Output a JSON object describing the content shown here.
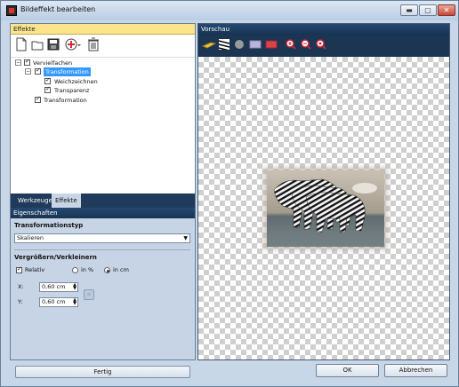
{
  "window": {
    "title": "Bildeffekt bearbeiten"
  },
  "titlebar": {
    "min": "▬",
    "max": "▢",
    "close": "✕"
  },
  "left_panel": {
    "header": "Effekte",
    "tree": [
      {
        "label": "Vervielfachen",
        "checked": true
      },
      {
        "label": "Transformation",
        "checked": true,
        "selected": true
      },
      {
        "label": "Weichzeichnen",
        "checked": true
      },
      {
        "label": "Transparenz",
        "checked": true
      },
      {
        "label": "Transformation",
        "checked": true
      }
    ],
    "tabs": [
      {
        "label": "Werkzeuge"
      },
      {
        "label": "Effekte",
        "active": true
      }
    ]
  },
  "properties": {
    "header": "Eigenschaften",
    "type_label": "Transformationstyp",
    "type_value": "Skalieren",
    "scale_label": "Vergrößern/Verkleinern",
    "relative_label": "Relativ",
    "percent_label": "in %",
    "cm_label": "in cm",
    "unit_selected": "cm",
    "x_label": "X:",
    "x_value": "0,60 cm",
    "y_label": "Y:",
    "y_value": "0,60 cm",
    "done_label": "Fertig"
  },
  "preview": {
    "header": "Vorschau"
  },
  "footer": {
    "ok": "OK",
    "cancel": "Abbrechen"
  },
  "colors": {
    "selection": "#3399ff",
    "panel_dark": "#1f3a5a",
    "accent_yellow": "#fce48c"
  }
}
